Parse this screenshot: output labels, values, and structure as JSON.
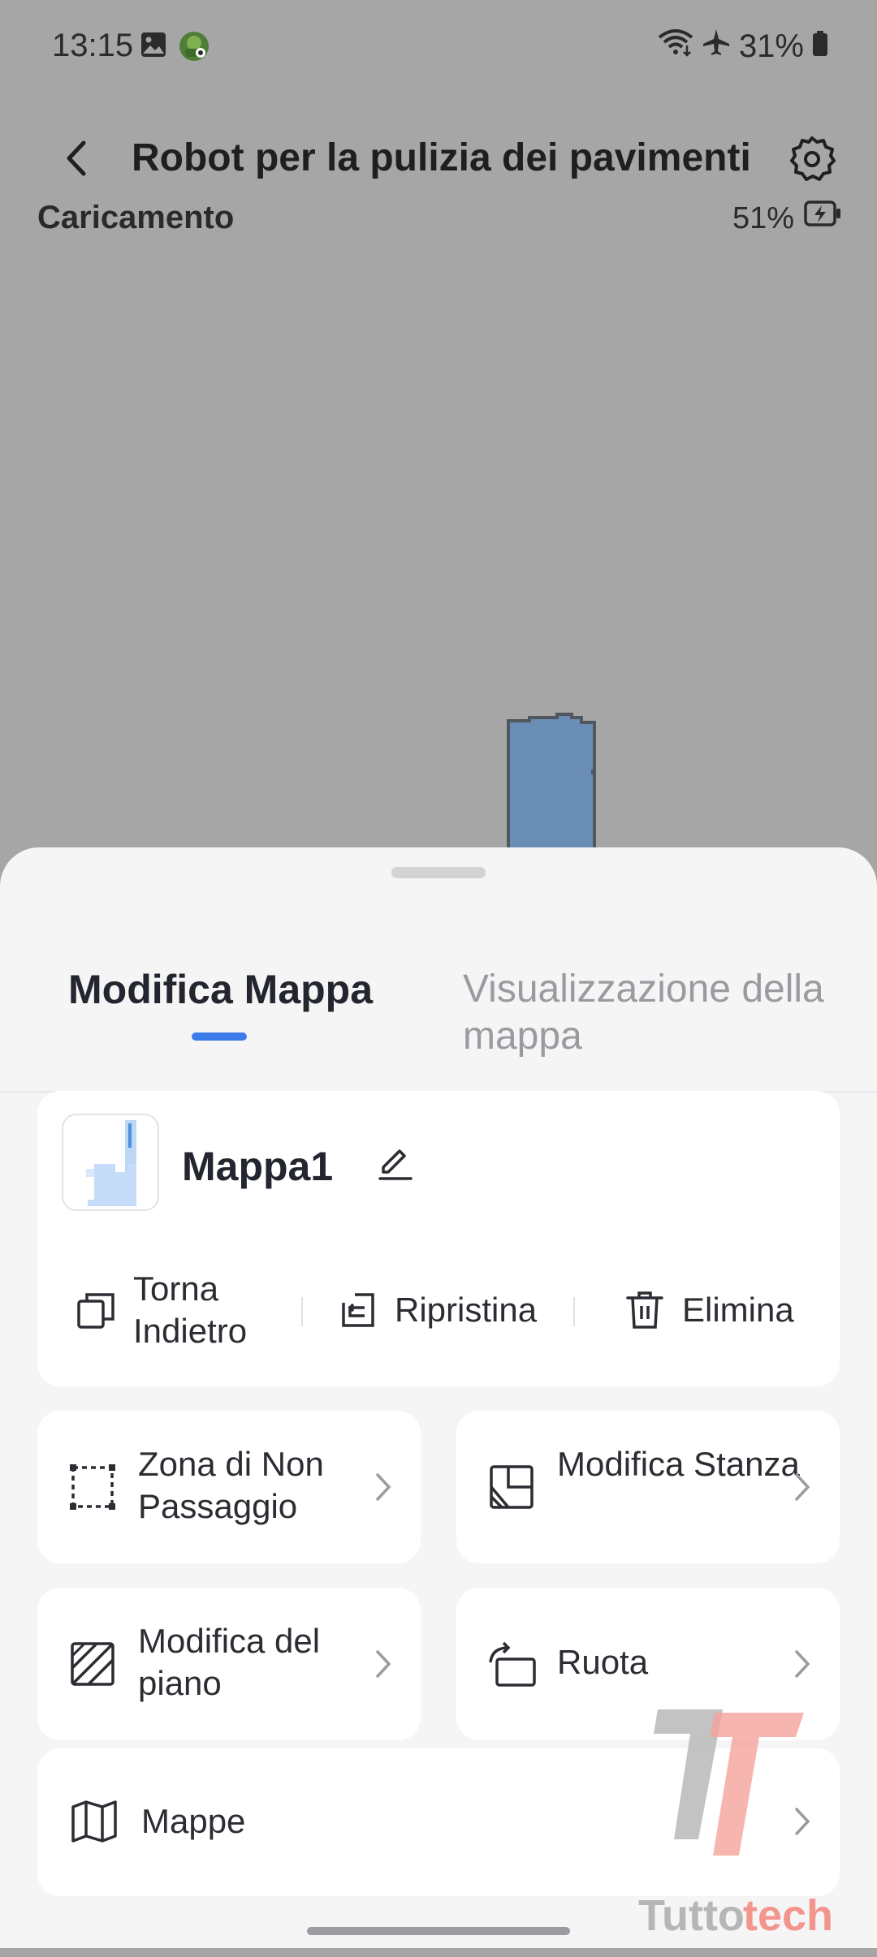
{
  "status_bar": {
    "time": "13:15",
    "battery_text": "31%",
    "icons": [
      "gallery-icon",
      "app-notification-icon",
      "wifi-icon",
      "airplane-mode-icon",
      "battery-icon"
    ]
  },
  "header": {
    "title": "Robot per la pulizia dei pavimenti",
    "back_icon": "chevron-left-icon",
    "settings_icon": "gear-icon"
  },
  "device_status": {
    "state": "Caricamento",
    "battery": "51%",
    "battery_icon": "battery-charging-icon"
  },
  "sheet": {
    "tabs": [
      {
        "label": "Modifica Mappa",
        "active": true
      },
      {
        "label": "Visualizzazione della mappa",
        "active": false
      }
    ],
    "map_card": {
      "name": "Mappa1",
      "actions": [
        {
          "label": "Torna Indietro",
          "icon": "copy-icon"
        },
        {
          "label": "Ripristina",
          "icon": "restore-icon"
        },
        {
          "label": "Elimina",
          "icon": "trash-icon"
        }
      ]
    },
    "tiles": [
      {
        "label": "Zona di Non Passaggio",
        "icon": "dashed-square-icon"
      },
      {
        "label": "Modifica Stanza",
        "icon": "room-layout-icon"
      },
      {
        "label": "Modifica del piano",
        "icon": "floor-hatch-icon"
      },
      {
        "label": "Ruota",
        "icon": "rotate-icon"
      }
    ],
    "maps_row": {
      "label": "Mappe",
      "icon": "map-icon"
    }
  },
  "watermark": {
    "text": "Tuttotech"
  },
  "colors": {
    "accent": "#3b7bea",
    "overlay": "#a6a6a6",
    "map_fill": "#6a8db5",
    "sheet_bg": "#f5f5f6",
    "card_bg": "#ffffff",
    "watermark_red": "#f28b82"
  }
}
